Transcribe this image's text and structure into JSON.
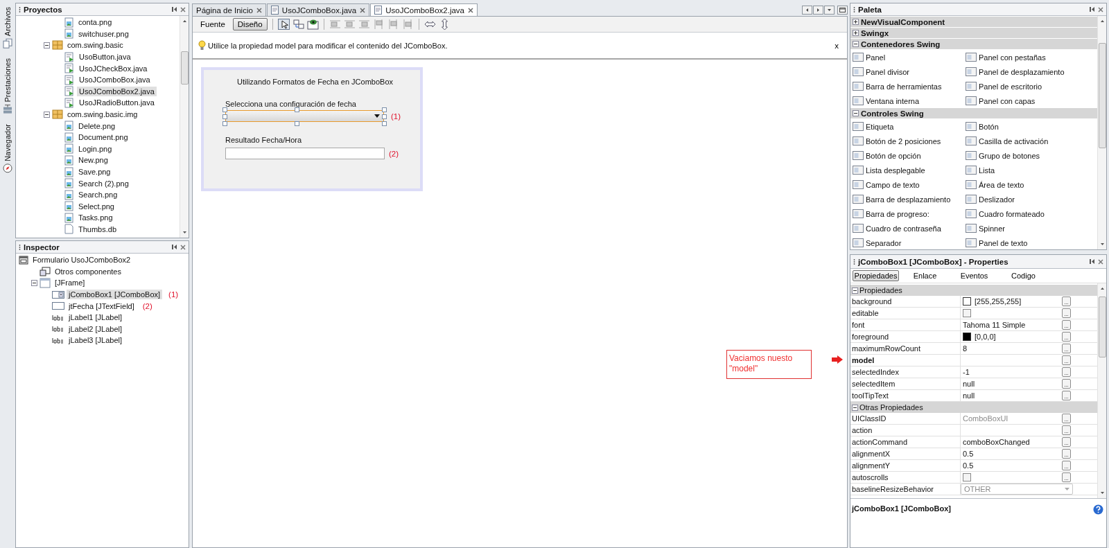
{
  "side_tabs": [
    {
      "label": "Archivos",
      "kind": "files"
    },
    {
      "label": "Prestaciones",
      "kind": "services"
    },
    {
      "label": "Navegador",
      "kind": "navigator"
    }
  ],
  "projects": {
    "title": "Proyectos",
    "items": [
      {
        "children": [
          {
            "label": "conta.png",
            "kind": "image",
            "selected": false
          },
          {
            "label": "switchuser.png",
            "kind": "image",
            "selected": false
          }
        ]
      },
      {
        "label": "com.swing.basic",
        "kind": "package",
        "selected": false,
        "expanded": true,
        "children": [
          {
            "label": "UsoButton.java",
            "kind": "java",
            "selected": false
          },
          {
            "label": "UsoJCheckBox.java",
            "kind": "java",
            "selected": false
          },
          {
            "label": "UsoJComboBox.java",
            "kind": "java",
            "selected": false
          },
          {
            "label": "UsoJComboBox2.java",
            "kind": "java",
            "selected": true
          },
          {
            "label": "UsoJRadioButton.java",
            "kind": "java",
            "selected": false
          }
        ]
      },
      {
        "label": "com.swing.basic.img",
        "kind": "package",
        "selected": false,
        "expanded": true,
        "children": [
          {
            "label": "Delete.png",
            "kind": "image",
            "selected": false
          },
          {
            "label": "Document.png",
            "kind": "image",
            "selected": false
          },
          {
            "label": "Login.png",
            "kind": "image",
            "selected": false
          },
          {
            "label": "New.png",
            "kind": "image",
            "selected": false
          },
          {
            "label": "Save.png",
            "kind": "image",
            "selected": false
          },
          {
            "label": "Search (2).png",
            "kind": "image",
            "selected": false
          },
          {
            "label": "Search.png",
            "kind": "image",
            "selected": false
          },
          {
            "label": "Select.png",
            "kind": "image",
            "selected": false
          },
          {
            "label": "Tasks.png",
            "kind": "image",
            "selected": false
          },
          {
            "label": "Thumbs.db",
            "kind": "file",
            "selected": false
          }
        ]
      }
    ]
  },
  "inspector": {
    "title": "Inspector",
    "items": [
      {
        "label": "Formulario UsoJComboBox2",
        "kind": "form",
        "selected": false,
        "children": [
          {
            "label": "Otros componentes",
            "kind": "components",
            "selected": false
          },
          {
            "label": "[JFrame]",
            "kind": "frame",
            "selected": false,
            "expanded": true,
            "children": [
              {
                "label": "jComboBox1 [JComboBox]",
                "kind": "combo",
                "selected": true,
                "note": "(1)"
              },
              {
                "label": "jtFecha [JTextField]",
                "kind": "textfield",
                "selected": false,
                "note": "(2)"
              },
              {
                "label": "jLabel1 [JLabel]",
                "kind": "label",
                "selected": false
              },
              {
                "label": "jLabel2 [JLabel]",
                "kind": "label",
                "selected": false
              },
              {
                "label": "jLabel3 [JLabel]",
                "kind": "label",
                "selected": false
              }
            ]
          }
        ]
      }
    ]
  },
  "editor": {
    "tabs": [
      {
        "label": "Página de Inicio",
        "kind": "page",
        "selected": false
      },
      {
        "label": "UsoJComboBox.java",
        "kind": "file",
        "selected": false
      },
      {
        "label": "UsoJComboBox2.java",
        "kind": "file",
        "selected": true
      }
    ],
    "views": [
      {
        "label": "Fuente",
        "selected": false
      },
      {
        "label": "Diseño",
        "selected": true
      }
    ],
    "hint": "Utilice la propiedad model para modificar el contenido del JComboBox.",
    "hint_close": "x",
    "form": {
      "title": "Utilizando Formatos de Fecha en JComboBox",
      "combo_label": "Selecciona una configuración de fecha",
      "combo_marker": "(1)",
      "result_label": "Resultado Fecha/Hora",
      "field_marker": "(2)"
    },
    "note": "Vaciamos nuesto \"model\""
  },
  "palette": {
    "title": "Paleta",
    "categories": [
      {
        "label": "NewVisualComponent",
        "expanded": false
      },
      {
        "label": "Swingx",
        "expanded": false
      },
      {
        "label": "Contenedores Swing",
        "expanded": true,
        "items": [
          "Panel",
          "Panel con pestañas",
          "Panel divisor",
          "Panel de desplazamiento",
          "Barra de herramientas",
          "Panel de escritorio",
          "Ventana interna",
          "Panel con capas"
        ]
      },
      {
        "label": "Controles Swing",
        "expanded": true,
        "items": [
          "Etiqueta",
          "Botón",
          "Botón de 2 posiciones",
          "Casilla de activación",
          "Botón de opción",
          "Grupo de botones",
          "Lista desplegable",
          "Lista",
          "Campo de texto",
          "Área de texto",
          "Barra de desplazamiento",
          "Deslizador",
          "Barra de progreso:",
          "Cuadro formateado",
          "Cuadro de contraseña",
          "Spinner",
          "Separador",
          "Panel de texto"
        ]
      }
    ]
  },
  "properties": {
    "title": "jComboBox1 [JComboBox] - Properties",
    "tabs": [
      {
        "label": "Propiedades",
        "selected": true
      },
      {
        "label": "Enlace",
        "selected": false
      },
      {
        "label": "Eventos",
        "selected": false
      },
      {
        "label": "Codigo",
        "selected": false
      }
    ],
    "sections": [
      {
        "label": "Propiedades",
        "expanded": true,
        "rows": [
          {
            "name": "background",
            "kind": "color",
            "color": "#ffffff",
            "value": "[255,255,255]",
            "bold": false,
            "action": "..."
          },
          {
            "name": "editable",
            "kind": "checkbox",
            "checked": false,
            "bold": false,
            "action": "..."
          },
          {
            "name": "font",
            "kind": "text",
            "value": "Tahoma 11 Simple",
            "bold": false,
            "action": "..."
          },
          {
            "name": "foreground",
            "kind": "color",
            "color": "#000000",
            "value": "[0,0,0]",
            "bold": false,
            "action": "..."
          },
          {
            "name": "maximumRowCount",
            "kind": "text",
            "value": "8",
            "bold": false,
            "action": "..."
          },
          {
            "name": "model",
            "kind": "text",
            "bold": true,
            "action": "..."
          },
          {
            "name": "selectedIndex",
            "kind": "text",
            "value": "-1",
            "bold": false,
            "action": "..."
          },
          {
            "name": "selectedItem",
            "kind": "text",
            "value": "null",
            "bold": false,
            "action": "..."
          },
          {
            "name": "toolTipText",
            "kind": "text",
            "value": "null",
            "bold": false,
            "action": "..."
          }
        ]
      },
      {
        "label": "Otras Propiedades",
        "expanded": true,
        "rows": [
          {
            "name": "UIClassID",
            "kind": "text",
            "value": "ComboBoxUI",
            "bold": false,
            "disabled": true,
            "action": "..."
          },
          {
            "name": "action",
            "kind": "text",
            "bold": false,
            "action": "..."
          },
          {
            "name": "actionCommand",
            "kind": "text",
            "value": "comboBoxChanged",
            "bold": false,
            "action": "..."
          },
          {
            "name": "alignmentX",
            "kind": "text",
            "value": "0.5",
            "bold": false,
            "action": "..."
          },
          {
            "name": "alignmentY",
            "kind": "text",
            "value": "0.5",
            "bold": false,
            "action": "..."
          },
          {
            "name": "autoscrolls",
            "kind": "checkbox",
            "checked": false,
            "bold": false,
            "action": "..."
          },
          {
            "name": "baselineResizeBehavior",
            "kind": "dropdown",
            "value": "OTHER",
            "bold": false,
            "disabled": true
          }
        ]
      }
    ],
    "description": "jComboBox1 [JComboBox]"
  }
}
